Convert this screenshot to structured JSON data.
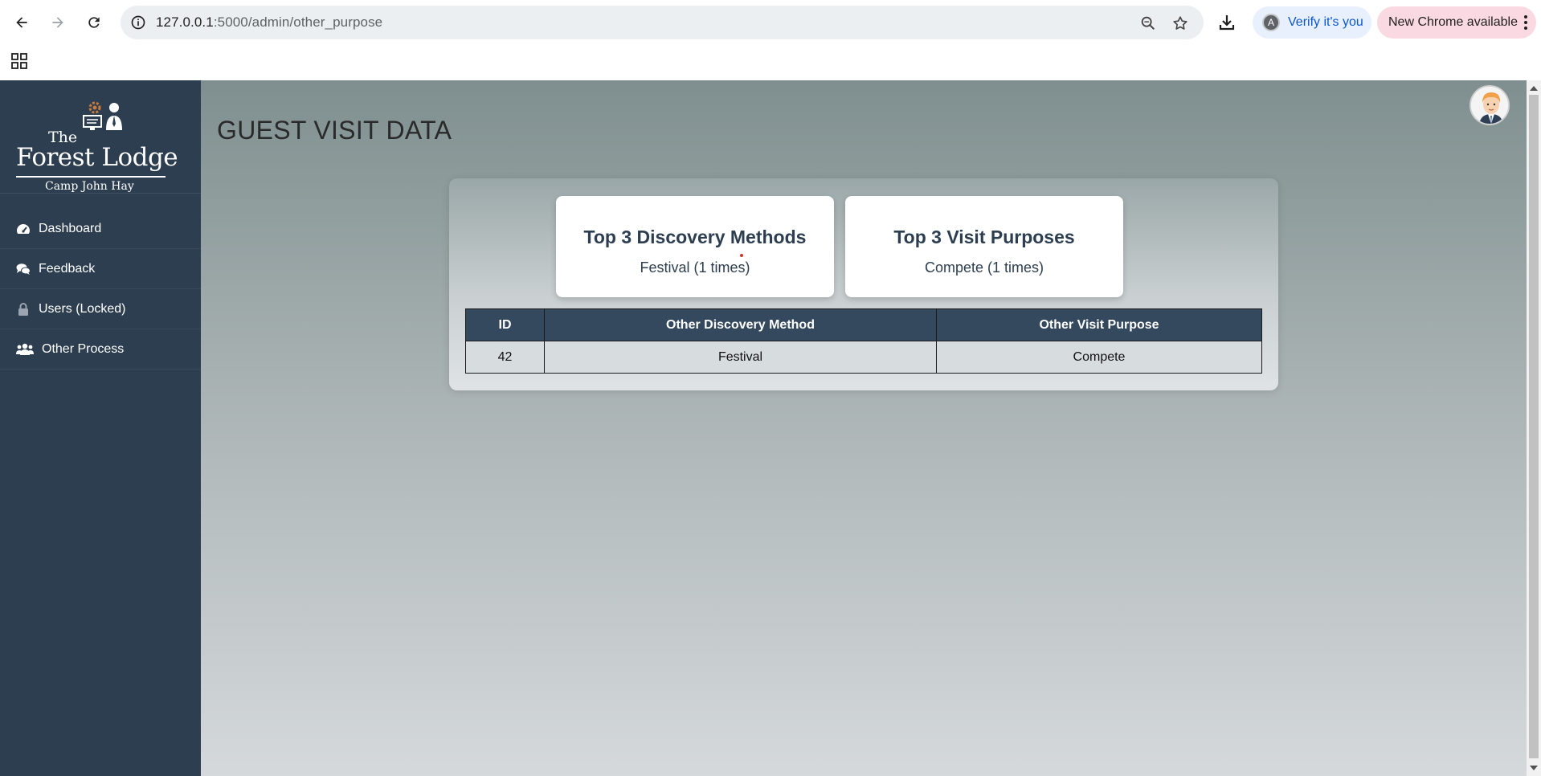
{
  "browser": {
    "url_host": "127.0.0.1",
    "url_rest": ":5000/admin/other_purpose",
    "verify_label": "Verify it's you",
    "verify_avatar": "A",
    "update_label": "New Chrome available"
  },
  "sidebar": {
    "logo": {
      "the": "The",
      "name": "Forest Lodge",
      "sub": "Camp John Hay"
    },
    "items": [
      {
        "label": "Dashboard",
        "icon": "speedometer-icon"
      },
      {
        "label": "Feedback",
        "icon": "comments-icon"
      },
      {
        "label": "Users (Locked)",
        "icon": "lock-icon"
      },
      {
        "label": "Other Process",
        "icon": "users-icon"
      }
    ]
  },
  "main": {
    "title": "GUEST VISIT DATA",
    "cards": [
      {
        "title": "Top 3 Discovery Methods",
        "value": "Festival (1 times)"
      },
      {
        "title": "Top 3 Visit Purposes",
        "value": "Compete (1 times)"
      }
    ],
    "table": {
      "headers": [
        "ID",
        "Other Discovery Method",
        "Other Visit Purpose"
      ],
      "rows": [
        [
          "42",
          "Festival",
          "Compete"
        ]
      ]
    }
  },
  "colors": {
    "sidebar_bg": "#2c3e50",
    "table_header_bg": "#34495e",
    "card_title": "#2c3e50"
  }
}
